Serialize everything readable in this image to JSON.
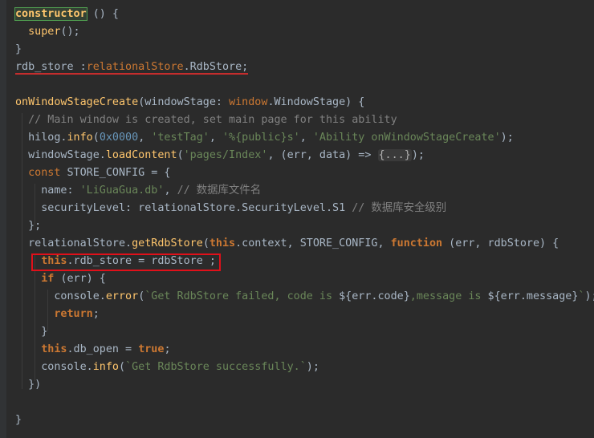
{
  "editor": {
    "lines": [
      [
        {
          "t": "constructor",
          "c": "hl-ctor"
        },
        {
          "t": " () {",
          "c": "ident"
        }
      ],
      [
        {
          "t": "  super",
          "c": "fn"
        },
        {
          "t": "();",
          "c": "ident"
        }
      ],
      [
        {
          "t": "}",
          "c": "ident"
        }
      ],
      [
        {
          "t": "rdb_store :",
          "c": "ident"
        },
        {
          "t": "relationalStore",
          "c": "type"
        },
        {
          "t": ".RdbStore;",
          "c": "ident"
        }
      ],
      [],
      [
        {
          "t": "onWindowStageCreate",
          "c": "fn"
        },
        {
          "t": "(windowStage: ",
          "c": "ident"
        },
        {
          "t": "window",
          "c": "type"
        },
        {
          "t": ".WindowStage) {",
          "c": "ident"
        }
      ],
      [
        {
          "t": "  // Main window is created, set main page for this ability",
          "c": "cmt"
        }
      ],
      [
        {
          "t": "  hilog.",
          "c": "ident"
        },
        {
          "t": "info",
          "c": "call"
        },
        {
          "t": "(",
          "c": "ident"
        },
        {
          "t": "0x0000",
          "c": "num"
        },
        {
          "t": ", ",
          "c": "ident"
        },
        {
          "t": "'testTag'",
          "c": "str"
        },
        {
          "t": ", ",
          "c": "ident"
        },
        {
          "t": "'%{public}s'",
          "c": "str"
        },
        {
          "t": ", ",
          "c": "ident"
        },
        {
          "t": "'Ability onWindowStageCreate'",
          "c": "str"
        },
        {
          "t": ");",
          "c": "ident"
        }
      ],
      [
        {
          "t": "  windowStage.",
          "c": "ident"
        },
        {
          "t": "loadContent",
          "c": "call"
        },
        {
          "t": "(",
          "c": "ident"
        },
        {
          "t": "'pages/Index'",
          "c": "str"
        },
        {
          "t": ", (err, data) => ",
          "c": "ident"
        },
        {
          "t": "{...}",
          "c": "fold"
        },
        {
          "t": ");",
          "c": "ident"
        }
      ],
      [
        {
          "t": "  const ",
          "c": "kw"
        },
        {
          "t": "STORE_CONFIG = {",
          "c": "ident"
        }
      ],
      [
        {
          "t": "    name: ",
          "c": "ident"
        },
        {
          "t": "'LiGuaGua.db'",
          "c": "str"
        },
        {
          "t": ", ",
          "c": "ident"
        },
        {
          "t": "// 数据库文件名",
          "c": "cmt"
        }
      ],
      [
        {
          "t": "    securityLevel: relationalStore.SecurityLevel.S1 ",
          "c": "ident"
        },
        {
          "t": "// 数据库安全级别",
          "c": "cmt"
        }
      ],
      [
        {
          "t": "  };",
          "c": "ident"
        }
      ],
      [
        {
          "t": "  relationalStore.",
          "c": "ident"
        },
        {
          "t": "getRdbStore",
          "c": "call"
        },
        {
          "t": "(",
          "c": "ident"
        },
        {
          "t": "this",
          "c": "kwb"
        },
        {
          "t": ".context, STORE_CONFIG, ",
          "c": "ident"
        },
        {
          "t": "function ",
          "c": "kwb"
        },
        {
          "t": "(err, rdbStore) {",
          "c": "ident"
        }
      ],
      [
        {
          "t": "    ",
          "c": "ident"
        },
        {
          "t": "this",
          "c": "kwb"
        },
        {
          "t": ".rdb_store = rdbStore ;",
          "c": "ident"
        }
      ],
      [
        {
          "t": "    ",
          "c": "ident"
        },
        {
          "t": "if ",
          "c": "kwb"
        },
        {
          "t": "(err) {",
          "c": "ident"
        }
      ],
      [
        {
          "t": "      console.",
          "c": "ident"
        },
        {
          "t": "error",
          "c": "call"
        },
        {
          "t": "(",
          "c": "ident"
        },
        {
          "t": "`Get RdbStore failed, code is ",
          "c": "tpl"
        },
        {
          "t": "${err.code}",
          "c": "ident"
        },
        {
          "t": ",message is ",
          "c": "tpl"
        },
        {
          "t": "${err.message}",
          "c": "ident"
        },
        {
          "t": "`",
          "c": "tpl"
        },
        {
          "t": ");",
          "c": "ident"
        }
      ],
      [
        {
          "t": "      ",
          "c": "ident"
        },
        {
          "t": "return",
          "c": "kwb"
        },
        {
          "t": ";",
          "c": "ident"
        }
      ],
      [
        {
          "t": "    }",
          "c": "ident"
        }
      ],
      [
        {
          "t": "    ",
          "c": "ident"
        },
        {
          "t": "this",
          "c": "kwb"
        },
        {
          "t": ".db_open = ",
          "c": "ident"
        },
        {
          "t": "true",
          "c": "kwb"
        },
        {
          "t": ";",
          "c": "ident"
        }
      ],
      [
        {
          "t": "    console.",
          "c": "ident"
        },
        {
          "t": "info",
          "c": "call"
        },
        {
          "t": "(",
          "c": "ident"
        },
        {
          "t": "`Get RdbStore successfully.`",
          "c": "tpl"
        },
        {
          "t": ");",
          "c": "ident"
        }
      ],
      [
        {
          "t": "  })",
          "c": "ident"
        }
      ],
      [],
      [
        {
          "t": "}",
          "c": "ident"
        }
      ]
    ]
  }
}
